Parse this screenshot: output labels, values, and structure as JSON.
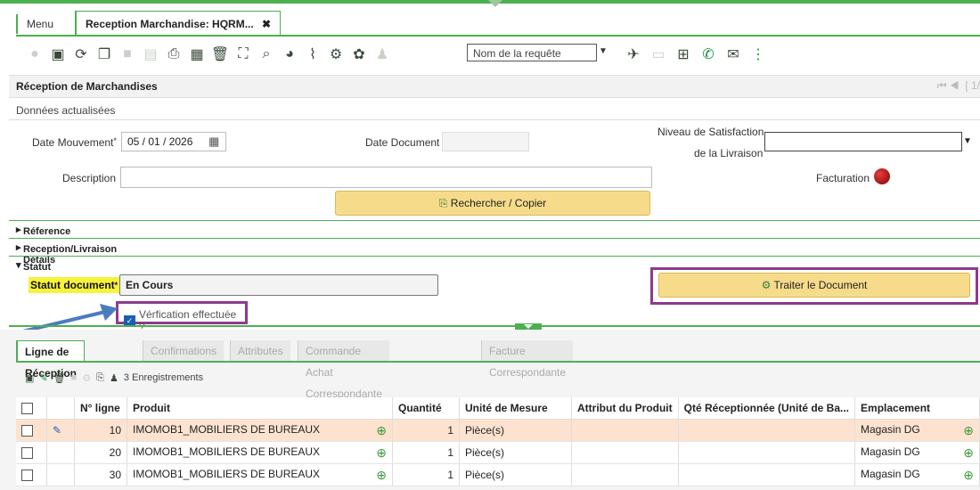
{
  "tabs": {
    "menu": "Menu",
    "active": "Reception Marchandise: HQRM...",
    "close": "✖"
  },
  "toolbar": {
    "request_placeholder": "Nom de la requête"
  },
  "header": {
    "title": "Réception de Marchandises",
    "pager": "[ 1/"
  },
  "subtitle": "Données actualisées",
  "form": {
    "date_mouvement_label": "Date Mouvement",
    "date_mouvement_value": "05 / 01 / 2026",
    "date_document_label": "Date Document",
    "niveau_label_1": "Niveau de Satisfaction",
    "niveau_label_2": "de la Livraison",
    "description_label": "Description",
    "facturation_label": "Facturation",
    "search_copy_button": "Rechercher / Copier"
  },
  "sections": {
    "reference": "Réference",
    "details": "Reception/Livraison Détails",
    "statut": "Statut"
  },
  "statut": {
    "label": "Statut document",
    "value": "En Cours",
    "verif_label": "Vérfication effectuée ?",
    "process_button": "Traiter le Document"
  },
  "lower_tabs": [
    "Ligne de Réception",
    "Confirmations",
    "Attributes",
    "Commande Achat Correspondante",
    "Facture Correspondante"
  ],
  "grid_toolbar": {
    "records": "3 Enregistrements"
  },
  "grid": {
    "columns": [
      "N° ligne",
      "Produit",
      "Quantité",
      "Unité de Mesure",
      "Attribut du Produit",
      "Qté Réceptionnée (Unité de Ba...",
      "Emplacement"
    ],
    "rows": [
      {
        "line": "10",
        "product": "IMOMOB1_MOBILIERS DE BUREAUX",
        "qty": "1",
        "uom": "Pièce(s)",
        "attr": "",
        "qty_rec": "",
        "location": "Magasin DG"
      },
      {
        "line": "20",
        "product": "IMOMOB1_MOBILIERS DE BUREAUX",
        "qty": "1",
        "uom": "Pièce(s)",
        "attr": "",
        "qty_rec": "",
        "location": "Magasin DG"
      },
      {
        "line": "30",
        "product": "IMOMOB1_MOBILIERS DE BUREAUX",
        "qty": "1",
        "uom": "Pièce(s)",
        "attr": "",
        "qty_rec": "",
        "location": "Magasin DG"
      }
    ]
  },
  "colors": {
    "accent": "#4caf50",
    "highlight_box": "#8e3a8e",
    "button_yellow": "#f6dc8a",
    "selected_row": "#fde3cf"
  }
}
